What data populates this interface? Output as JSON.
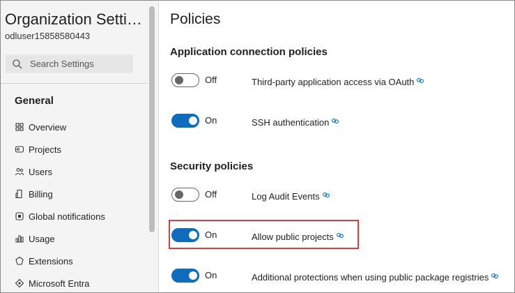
{
  "sidebar": {
    "org_title": "Organization Settin...",
    "user": "odluser15858580443",
    "search_placeholder": "Search Settings",
    "section": "General",
    "items": [
      {
        "label": "Overview",
        "icon": "overview-icon"
      },
      {
        "label": "Projects",
        "icon": "projects-icon"
      },
      {
        "label": "Users",
        "icon": "users-icon"
      },
      {
        "label": "Billing",
        "icon": "billing-icon"
      },
      {
        "label": "Global notifications",
        "icon": "notifications-icon"
      },
      {
        "label": "Usage",
        "icon": "usage-icon"
      },
      {
        "label": "Extensions",
        "icon": "extensions-icon"
      },
      {
        "label": "Microsoft Entra",
        "icon": "entra-icon"
      }
    ]
  },
  "main": {
    "title": "Policies",
    "sections": [
      {
        "title": "Application connection policies",
        "policies": [
          {
            "state": "Off",
            "enabled": false,
            "label": "Third-party application access via OAuth"
          },
          {
            "state": "On",
            "enabled": true,
            "label": "SSH authentication"
          }
        ]
      },
      {
        "title": "Security policies",
        "policies": [
          {
            "state": "Off",
            "enabled": false,
            "label": "Log Audit Events"
          },
          {
            "state": "On",
            "enabled": true,
            "label": "Allow public projects"
          },
          {
            "state": "On",
            "enabled": true,
            "label": "Additional protections when using public package registries"
          }
        ]
      }
    ]
  },
  "colors": {
    "toggle_on": "#0f6cbd",
    "highlight_border": "#e0393e",
    "sidebar_bg": "#f4f4f4"
  }
}
